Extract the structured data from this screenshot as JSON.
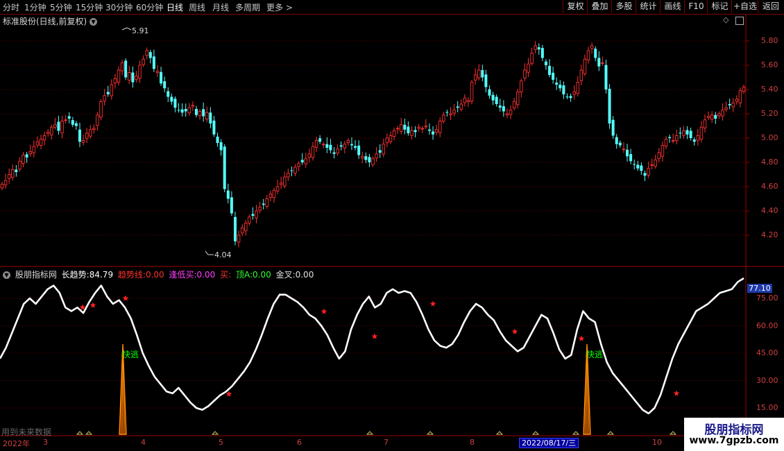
{
  "toolbar": {
    "periods": [
      "分时",
      "1分钟",
      "5分钟",
      "15分钟",
      "30分钟",
      "60分钟",
      "日线",
      "周线",
      "月线",
      "多周期",
      "更多 >"
    ],
    "active_period": "日线",
    "right_buttons": [
      "复权",
      "叠加",
      "多股",
      "统计",
      "画线",
      "F10",
      "标记",
      "+自选",
      "返回"
    ]
  },
  "main_chart": {
    "stock_title": "标准股份(日线,前复权)",
    "price_axis": [
      "5.80",
      "5.60",
      "5.40",
      "5.20",
      "5.00",
      "4.80",
      "4.60",
      "4.40",
      "4.20"
    ],
    "high_label": "5.91",
    "low_label": "4.04"
  },
  "indicator": {
    "name": "股朋指标网",
    "long_trend": {
      "label": "长趋势:",
      "value": "84.79"
    },
    "trend_line": {
      "label": "趋势线:",
      "value": "0.00"
    },
    "dip_buy": {
      "label": "逢低买:",
      "value": "0.00"
    },
    "buy": {
      "label": "买:",
      "value": ""
    },
    "top_a": {
      "label": "顶A:",
      "value": "0.00"
    },
    "golden_cross": {
      "label": "金叉:",
      "value": "0.00"
    },
    "axis": [
      "75.00",
      "60.00",
      "45.00",
      "30.00",
      "15.00"
    ],
    "current_value": "77.10",
    "signal_text": "快逃",
    "notice": "用到未来数据"
  },
  "time_axis": {
    "year": "2022年",
    "months": [
      "3",
      "4",
      "5",
      "6",
      "7",
      "8",
      "10"
    ],
    "cursor_date": "2022/08/17/三"
  },
  "watermark": {
    "line1": "股朋指标网",
    "line2": "www.7gpzb.com"
  },
  "colors": {
    "up": "#ff3232",
    "down": "#54ffff",
    "line": "#ffffff",
    "signal_bar": "#ff8c00",
    "signal_text": "#00ff00",
    "star": "#ff2020",
    "axis": "#d04040",
    "grid": "#700000"
  },
  "chart_data": {
    "type": "candlestick",
    "price_range": [
      4.04,
      5.91
    ],
    "closes": [
      4.62,
      4.65,
      4.7,
      4.74,
      4.72,
      4.81,
      4.86,
      4.84,
      4.89,
      4.93,
      4.97,
      4.99,
      5.02,
      5.05,
      5.09,
      5.11,
      5.06,
      5.14,
      5.15,
      5.16,
      5.11,
      5.1,
      4.97,
      4.98,
      5.04,
      5.07,
      5.08,
      5.19,
      5.3,
      5.35,
      5.36,
      5.44,
      5.49,
      5.56,
      5.62,
      5.5,
      5.54,
      5.46,
      5.51,
      5.6,
      5.65,
      5.72,
      5.66,
      5.57,
      5.55,
      5.45,
      5.41,
      5.34,
      5.3,
      5.25,
      5.23,
      5.21,
      5.22,
      5.25,
      5.27,
      5.19,
      5.22,
      5.18,
      5.21,
      5.12,
      5.03,
      4.96,
      4.9,
      4.58,
      4.5,
      4.38,
      4.15,
      4.2,
      4.26,
      4.3,
      4.35,
      4.36,
      4.4,
      4.43,
      4.45,
      4.5,
      4.54,
      4.57,
      4.6,
      4.63,
      4.68,
      4.71,
      4.73,
      4.76,
      4.79,
      4.8,
      4.83,
      4.87,
      4.93,
      4.98,
      4.97,
      4.95,
      4.92,
      4.9,
      4.87,
      4.91,
      4.93,
      4.95,
      4.98,
      4.94,
      4.92,
      4.86,
      4.85,
      4.82,
      4.8,
      4.83,
      4.87,
      4.88,
      4.95,
      5.0,
      5.02,
      5.06,
      5.08,
      5.11,
      5.07,
      5.04,
      5.06,
      5.05,
      5.09,
      5.08,
      5.1,
      5.06,
      5.03,
      5.07,
      5.14,
      5.19,
      5.21,
      5.2,
      5.23,
      5.25,
      5.28,
      5.33,
      5.31,
      5.46,
      5.52,
      5.56,
      5.5,
      5.42,
      5.35,
      5.31,
      5.28,
      5.25,
      5.22,
      5.2,
      5.23,
      5.3,
      5.38,
      5.47,
      5.56,
      5.61,
      5.7,
      5.76,
      5.73,
      5.66,
      5.6,
      5.52,
      5.48,
      5.44,
      5.41,
      5.36,
      5.34,
      5.33,
      5.38,
      5.46,
      5.56,
      5.65,
      5.72,
      5.76,
      5.66,
      5.59,
      5.62,
      5.4,
      5.12,
      5.02,
      4.95,
      4.94,
      4.91,
      4.85,
      4.81,
      4.78,
      4.75,
      4.73,
      4.69,
      4.75,
      4.78,
      4.82,
      4.88,
      4.94,
      4.99,
      5.0,
      4.98,
      5.02,
      5.04,
      5.06,
      5.03,
      5.0,
      4.97,
      5.02,
      5.09,
      5.15,
      5.18,
      5.19,
      5.16,
      5.2,
      5.23,
      5.25,
      5.27,
      5.29,
      5.32,
      5.39,
      5.42
    ],
    "indicator_line": {
      "name": "长趋势",
      "range": [
        0,
        100
      ],
      "values": [
        42,
        48,
        56,
        64,
        72,
        75,
        72,
        76,
        80,
        82,
        78,
        70,
        68,
        70,
        67,
        73,
        78,
        82,
        76,
        72,
        74,
        70,
        64,
        55,
        45,
        38,
        32,
        28,
        24,
        23,
        26,
        22,
        18,
        15,
        14,
        16,
        19,
        22,
        24,
        27,
        31,
        35,
        40,
        47,
        55,
        64,
        72,
        77,
        77,
        75,
        73,
        70,
        66,
        64,
        60,
        55,
        48,
        42,
        46,
        58,
        66,
        72,
        76,
        70,
        72,
        78,
        80,
        78,
        79,
        78,
        73,
        66,
        58,
        52,
        49,
        48,
        50,
        55,
        62,
        68,
        72,
        70,
        66,
        63,
        57,
        52,
        49,
        46,
        48,
        54,
        60,
        66,
        64,
        56,
        47,
        42,
        44,
        58,
        68,
        64,
        62,
        50,
        40,
        34,
        30,
        26,
        22,
        18,
        14,
        12,
        15,
        22,
        32,
        42,
        50,
        56,
        62,
        68,
        70,
        72,
        75,
        78,
        79,
        80,
        84,
        86
      ]
    },
    "signals": {
      "name": "快逃",
      "peak": 50
    }
  }
}
